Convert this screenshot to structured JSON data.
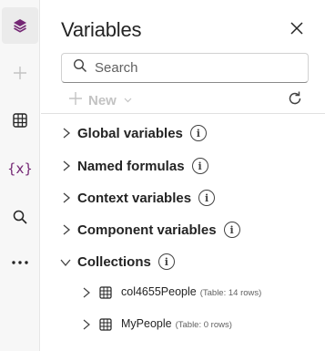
{
  "rail": {
    "items": [
      {
        "name": "layers",
        "icon": "layers-icon"
      },
      {
        "name": "insert",
        "icon": "plus-icon"
      },
      {
        "name": "data",
        "icon": "table-icon"
      },
      {
        "name": "variables",
        "icon": "variables-icon",
        "text": "{x}"
      },
      {
        "name": "search",
        "icon": "search-icon"
      },
      {
        "name": "more",
        "icon": "more-icon"
      }
    ]
  },
  "panel": {
    "title": "Variables",
    "search_placeholder": "Search",
    "toolbar": {
      "new_label": "New",
      "new_chevron": "⌄"
    },
    "sections": [
      {
        "label": "Global variables",
        "expanded": false
      },
      {
        "label": "Named formulas",
        "expanded": false
      },
      {
        "label": "Context variables",
        "expanded": false
      },
      {
        "label": "Component variables",
        "expanded": false
      },
      {
        "label": "Collections",
        "expanded": true
      }
    ],
    "info_glyph": "i",
    "collections": [
      {
        "name": "col4655People",
        "meta": "(Table: 14 rows)"
      },
      {
        "name": "MyPeople",
        "meta": "(Table: 0 rows)"
      }
    ]
  },
  "colors": {
    "accent": "#742774",
    "text": "#242424",
    "disabled": "#c3c3c3"
  }
}
